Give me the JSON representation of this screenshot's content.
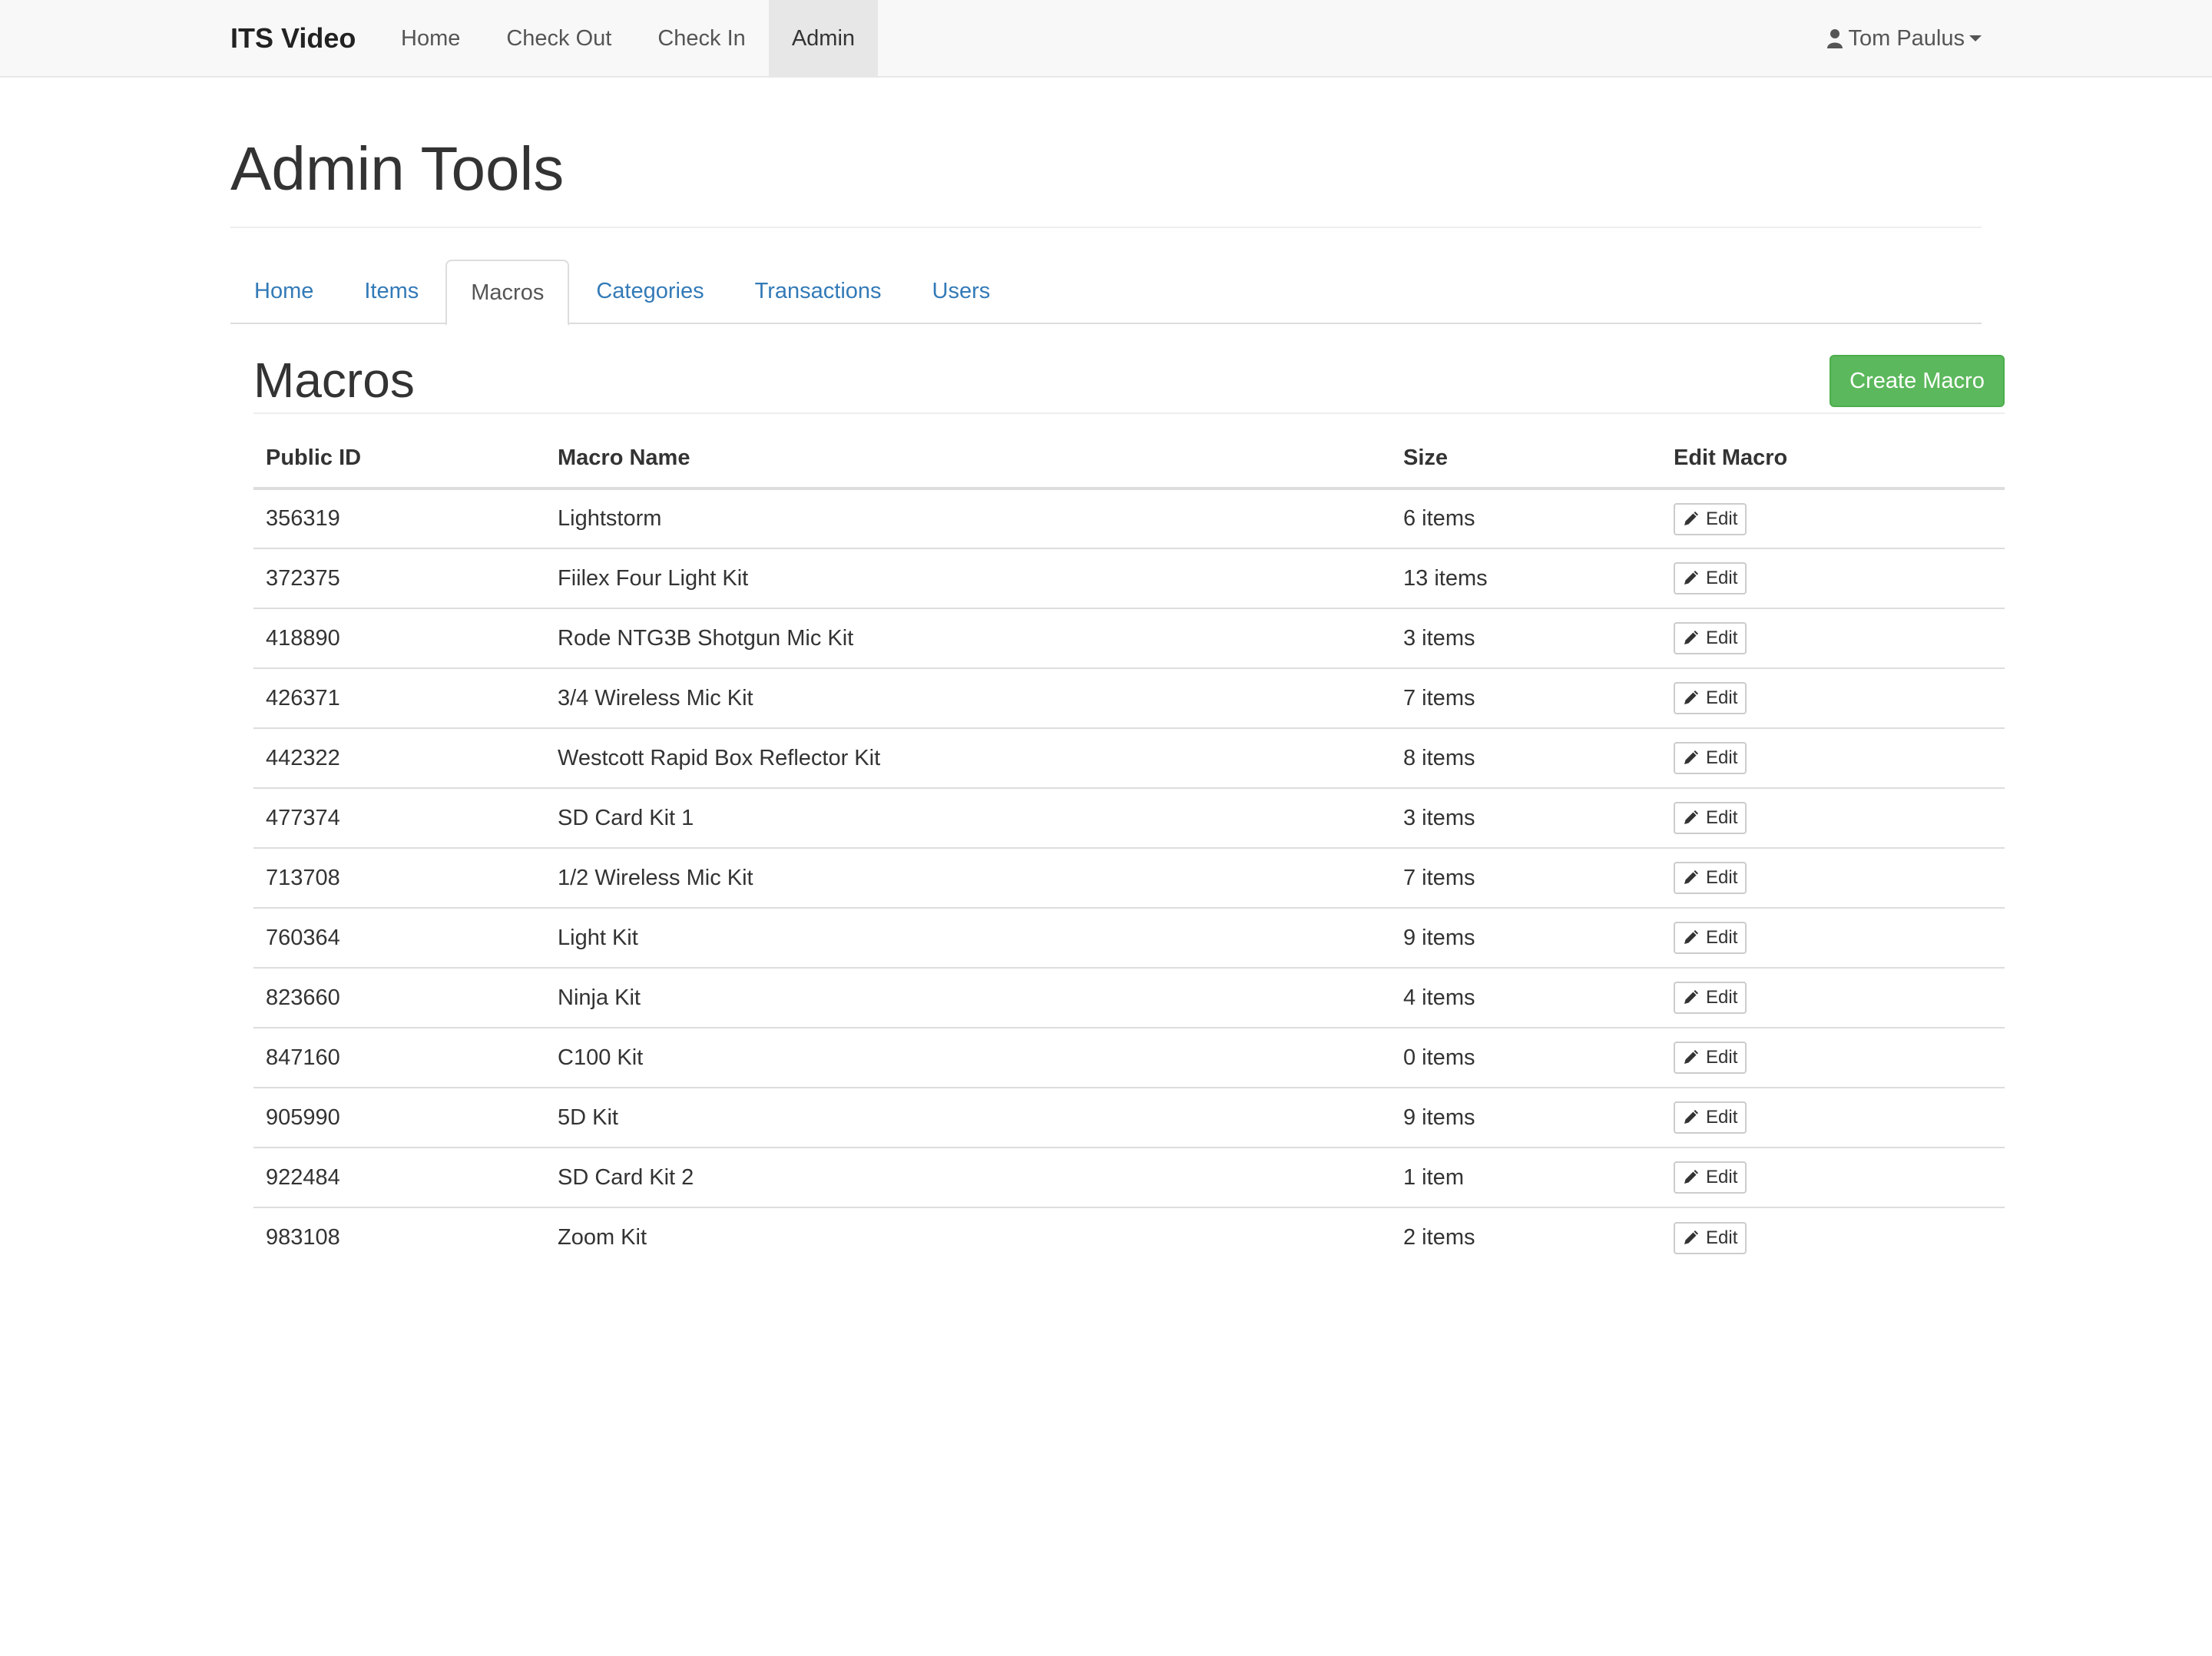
{
  "navbar": {
    "brand": "ITS Video",
    "links": [
      {
        "label": "Home"
      },
      {
        "label": "Check Out"
      },
      {
        "label": "Check In"
      },
      {
        "label": "Admin",
        "active": true
      }
    ],
    "user": {
      "name": "Tom Paulus",
      "icon": "user-icon"
    }
  },
  "page": {
    "title": "Admin Tools"
  },
  "tabs": [
    {
      "label": "Home"
    },
    {
      "label": "Items"
    },
    {
      "label": "Macros",
      "active": true
    },
    {
      "label": "Categories"
    },
    {
      "label": "Transactions"
    },
    {
      "label": "Users"
    }
  ],
  "section": {
    "title": "Macros",
    "create_label": "Create Macro"
  },
  "table": {
    "columns": [
      "Public ID",
      "Macro Name",
      "Size",
      "Edit Macro"
    ],
    "edit_label": "Edit",
    "rows": [
      {
        "id": "356319",
        "name": "Lightstorm",
        "size": "6 items"
      },
      {
        "id": "372375",
        "name": "Fiilex Four Light Kit",
        "size": "13 items"
      },
      {
        "id": "418890",
        "name": "Rode NTG3B Shotgun Mic Kit",
        "size": "3 items"
      },
      {
        "id": "426371",
        "name": "3/4 Wireless Mic Kit",
        "size": "7 items"
      },
      {
        "id": "442322",
        "name": "Westcott Rapid Box Reflector Kit",
        "size": "8 items"
      },
      {
        "id": "477374",
        "name": "SD Card Kit 1",
        "size": "3 items"
      },
      {
        "id": "713708",
        "name": "1/2 Wireless Mic Kit",
        "size": "7 items"
      },
      {
        "id": "760364",
        "name": "Light Kit",
        "size": "9 items"
      },
      {
        "id": "823660",
        "name": "Ninja Kit",
        "size": "4 items"
      },
      {
        "id": "847160",
        "name": "C100 Kit",
        "size": "0 items"
      },
      {
        "id": "905990",
        "name": "5D Kit",
        "size": "9 items"
      },
      {
        "id": "922484",
        "name": "SD Card Kit 2",
        "size": "1 item"
      },
      {
        "id": "983108",
        "name": "Zoom Kit",
        "size": "2 items"
      }
    ]
  },
  "colors": {
    "primary_link": "#337ab7",
    "success": "#5cb85c",
    "navbar_bg": "#f8f8f8"
  }
}
